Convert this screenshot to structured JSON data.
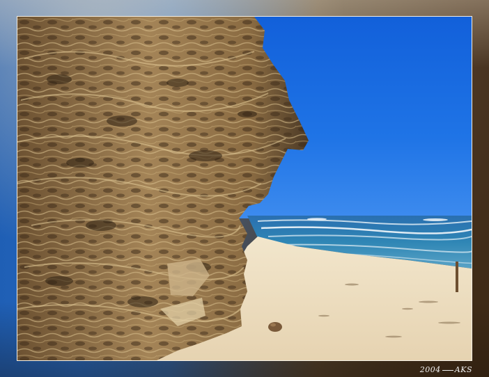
{
  "photo": {
    "signature": {
      "year": "2004",
      "initials": "AKS"
    }
  },
  "colors": {
    "sky": "#1f74e6",
    "sea": "#2a6fb0",
    "sand": "#efe2c6",
    "rock": "#8a6b42",
    "frame_border": "#f4efe4"
  }
}
